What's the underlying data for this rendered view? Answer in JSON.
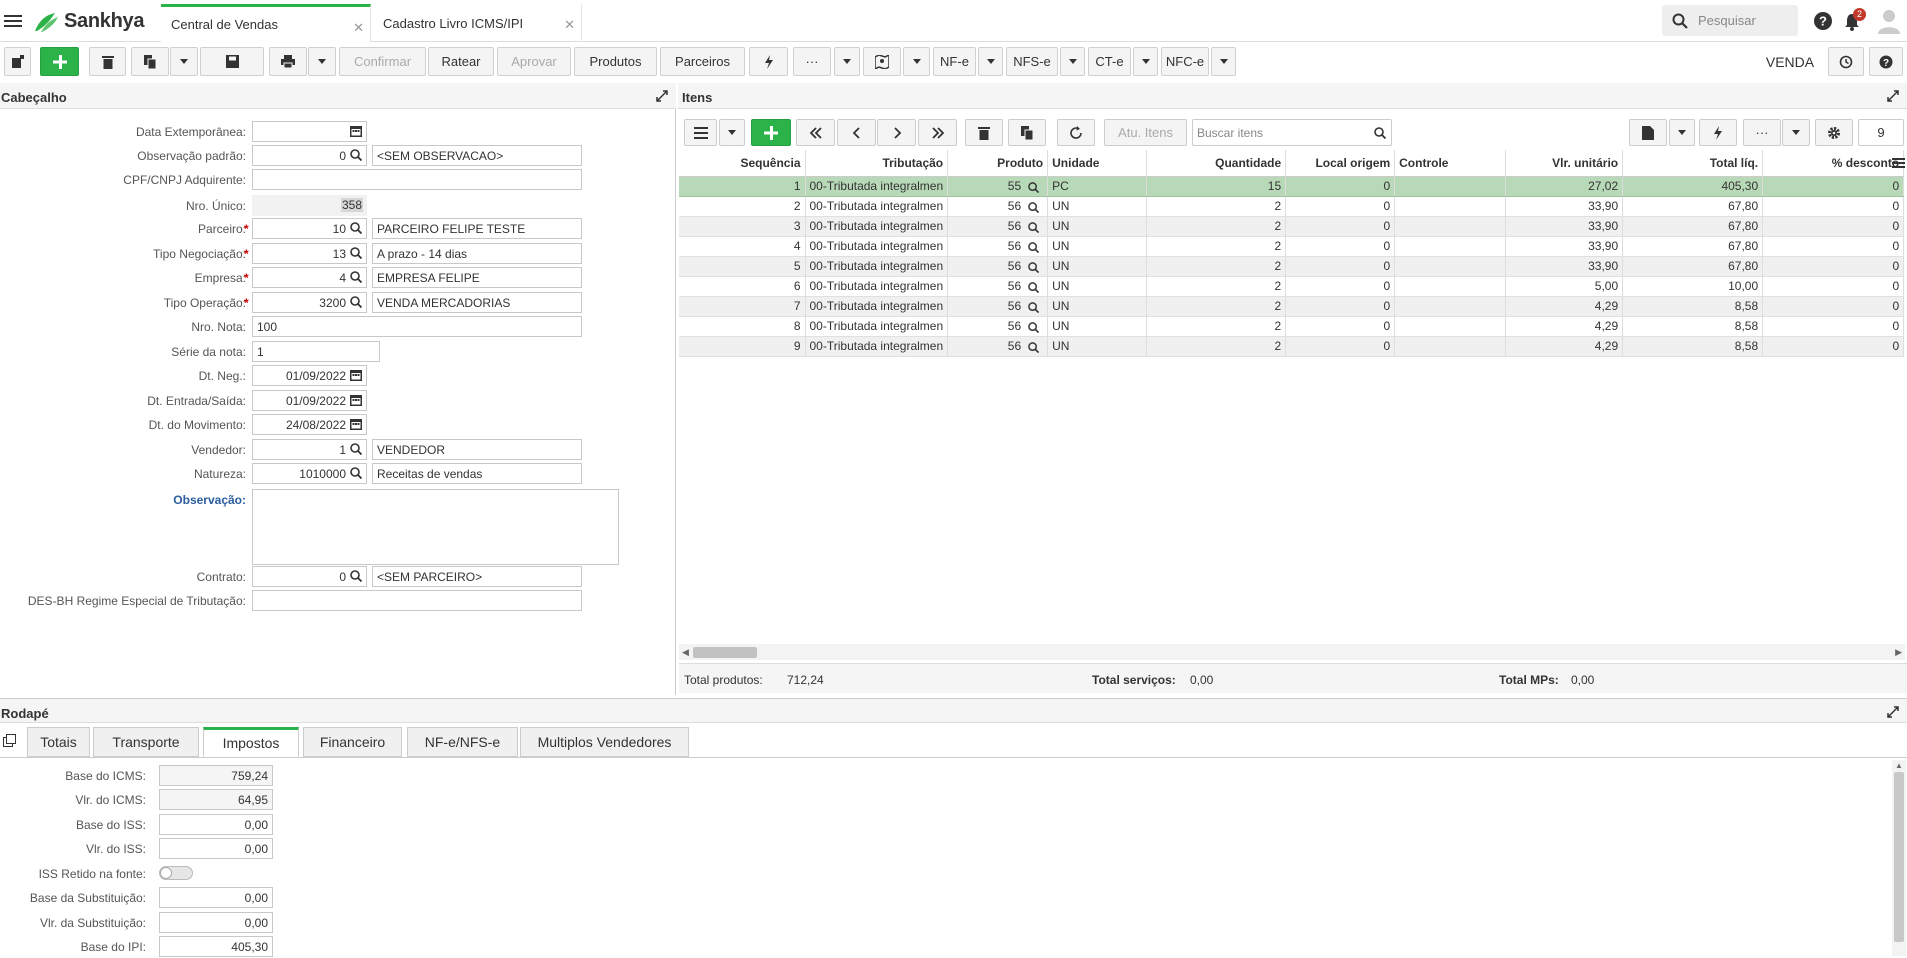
{
  "brand": {
    "name": "Sankhya"
  },
  "tabs": [
    {
      "label": "Central de Vendas",
      "active": true
    },
    {
      "label": "Cadastro Livro ICMS/IPI",
      "active": false
    }
  ],
  "search": {
    "placeholder": "Pesquisar"
  },
  "notifications": {
    "count": "2"
  },
  "toolbar": {
    "confirmar": "Confirmar",
    "ratear": "Ratear",
    "aprovar": "Aprovar",
    "produtos": "Produtos",
    "parceiros": "Parceiros",
    "more": "···",
    "nfe": "NF-e",
    "nfse": "NFS-e",
    "cte": "CT-e",
    "nfce": "NFC-e",
    "mode": "VENDA"
  },
  "cabecalho": {
    "title": "Cabeçalho",
    "fields": {
      "data_extemporanea": {
        "label": "Data Extemporânea:",
        "value": ""
      },
      "observacao_padrao": {
        "label": "Observação padrão:",
        "code": "0",
        "desc": "<SEM OBSERVACAO>"
      },
      "cpf_cnpj": {
        "label": "CPF/CNPJ Adquirente:",
        "value": ""
      },
      "nro_unico": {
        "label": "Nro. Único:",
        "value": "358"
      },
      "parceiro": {
        "label": "Parceiro:",
        "code": "10",
        "desc": "PARCEIRO FELIPE TESTE"
      },
      "tipo_negociacao": {
        "label": "Tipo Negociação:",
        "code": "13",
        "desc": "A prazo - 14 dias"
      },
      "empresa": {
        "label": "Empresa:",
        "code": "4",
        "desc": "EMPRESA FELIPE"
      },
      "tipo_operacao": {
        "label": "Tipo Operação:",
        "code": "3200",
        "desc": "VENDA MERCADORIAS"
      },
      "nro_nota": {
        "label": "Nro. Nota:",
        "value": "100"
      },
      "serie_nota": {
        "label": "Série da nota:",
        "value": "1"
      },
      "dt_neg": {
        "label": "Dt. Neg.:",
        "value": "01/09/2022"
      },
      "dt_entrada": {
        "label": "Dt. Entrada/Saída:",
        "value": "01/09/2022"
      },
      "dt_movimento": {
        "label": "Dt. do Movimento:",
        "value": "24/08/2022"
      },
      "vendedor": {
        "label": "Vendedor:",
        "code": "1",
        "desc": "VENDEDOR"
      },
      "natureza": {
        "label": "Natureza:",
        "code": "1010000",
        "desc": "Receitas de vendas"
      },
      "observacao": {
        "label": "Observação:",
        "value": ""
      },
      "contrato": {
        "label": "Contrato:",
        "code": "0",
        "desc": "<SEM PARCEIRO>"
      },
      "des_bh": {
        "label": "DES-BH Regime Especial de Tributação:",
        "value": ""
      }
    }
  },
  "itens": {
    "title": "Itens",
    "atu_itens": "Atu. Itens",
    "search_placeholder": "Buscar itens",
    "page_size": "9",
    "columns": [
      "Sequência",
      "Tributação",
      "Produto",
      "Unidade",
      "Quantidade",
      "Local origem",
      "Controle",
      "Vlr. unitário",
      "Total líq.",
      "% desconto"
    ],
    "rows": [
      [
        "1",
        "00-Tributada integralmen",
        "55",
        "PC",
        "15",
        "0",
        "",
        "27,02",
        "405,30",
        "0"
      ],
      [
        "2",
        "00-Tributada integralmen",
        "56",
        "UN",
        "2",
        "0",
        "",
        "33,90",
        "67,80",
        "0"
      ],
      [
        "3",
        "00-Tributada integralmen",
        "56",
        "UN",
        "2",
        "0",
        "",
        "33,90",
        "67,80",
        "0"
      ],
      [
        "4",
        "00-Tributada integralmen",
        "56",
        "UN",
        "2",
        "0",
        "",
        "33,90",
        "67,80",
        "0"
      ],
      [
        "5",
        "00-Tributada integralmen",
        "56",
        "UN",
        "2",
        "0",
        "",
        "33,90",
        "67,80",
        "0"
      ],
      [
        "6",
        "00-Tributada integralmen",
        "56",
        "UN",
        "2",
        "0",
        "",
        "5,00",
        "10,00",
        "0"
      ],
      [
        "7",
        "00-Tributada integralmen",
        "56",
        "UN",
        "2",
        "0",
        "",
        "4,29",
        "8,58",
        "0"
      ],
      [
        "8",
        "00-Tributada integralmen",
        "56",
        "UN",
        "2",
        "0",
        "",
        "4,29",
        "8,58",
        "0"
      ],
      [
        "9",
        "00-Tributada integralmen",
        "56",
        "UN",
        "2",
        "0",
        "",
        "4,29",
        "8,58",
        "0"
      ]
    ],
    "totals": {
      "produtos_label": "Total produtos:",
      "produtos": "712,24",
      "servicos_label": "Total serviços:",
      "servicos": "0,00",
      "mps_label": "Total MPs:",
      "mps": "0,00"
    }
  },
  "rodape": {
    "title": "Rodapé",
    "tabs": [
      "Totais",
      "Transporte",
      "Impostos",
      "Financeiro",
      "NF-e/NFS-e",
      "Multiplos Vendedores"
    ],
    "active_tab": "Impostos",
    "fields": [
      {
        "label": "Base do ICMS:",
        "value": "759,24"
      },
      {
        "label": "Vlr. do ICMS:",
        "value": "64,95"
      },
      {
        "label": "Base do ISS:",
        "value": "0,00"
      },
      {
        "label": "Vlr. do ISS:",
        "value": "0,00"
      },
      {
        "label": "ISS Retido na fonte:",
        "value": ""
      },
      {
        "label": "Base da Substituição:",
        "value": "0,00"
      },
      {
        "label": "Vlr. da Substituição:",
        "value": "0,00"
      },
      {
        "label": "Base do IPI:",
        "value": "405,30"
      }
    ]
  },
  "colors": {
    "accent": "#2bb34a",
    "selected_row": "#b8d9b8",
    "required": "#cc0000"
  }
}
